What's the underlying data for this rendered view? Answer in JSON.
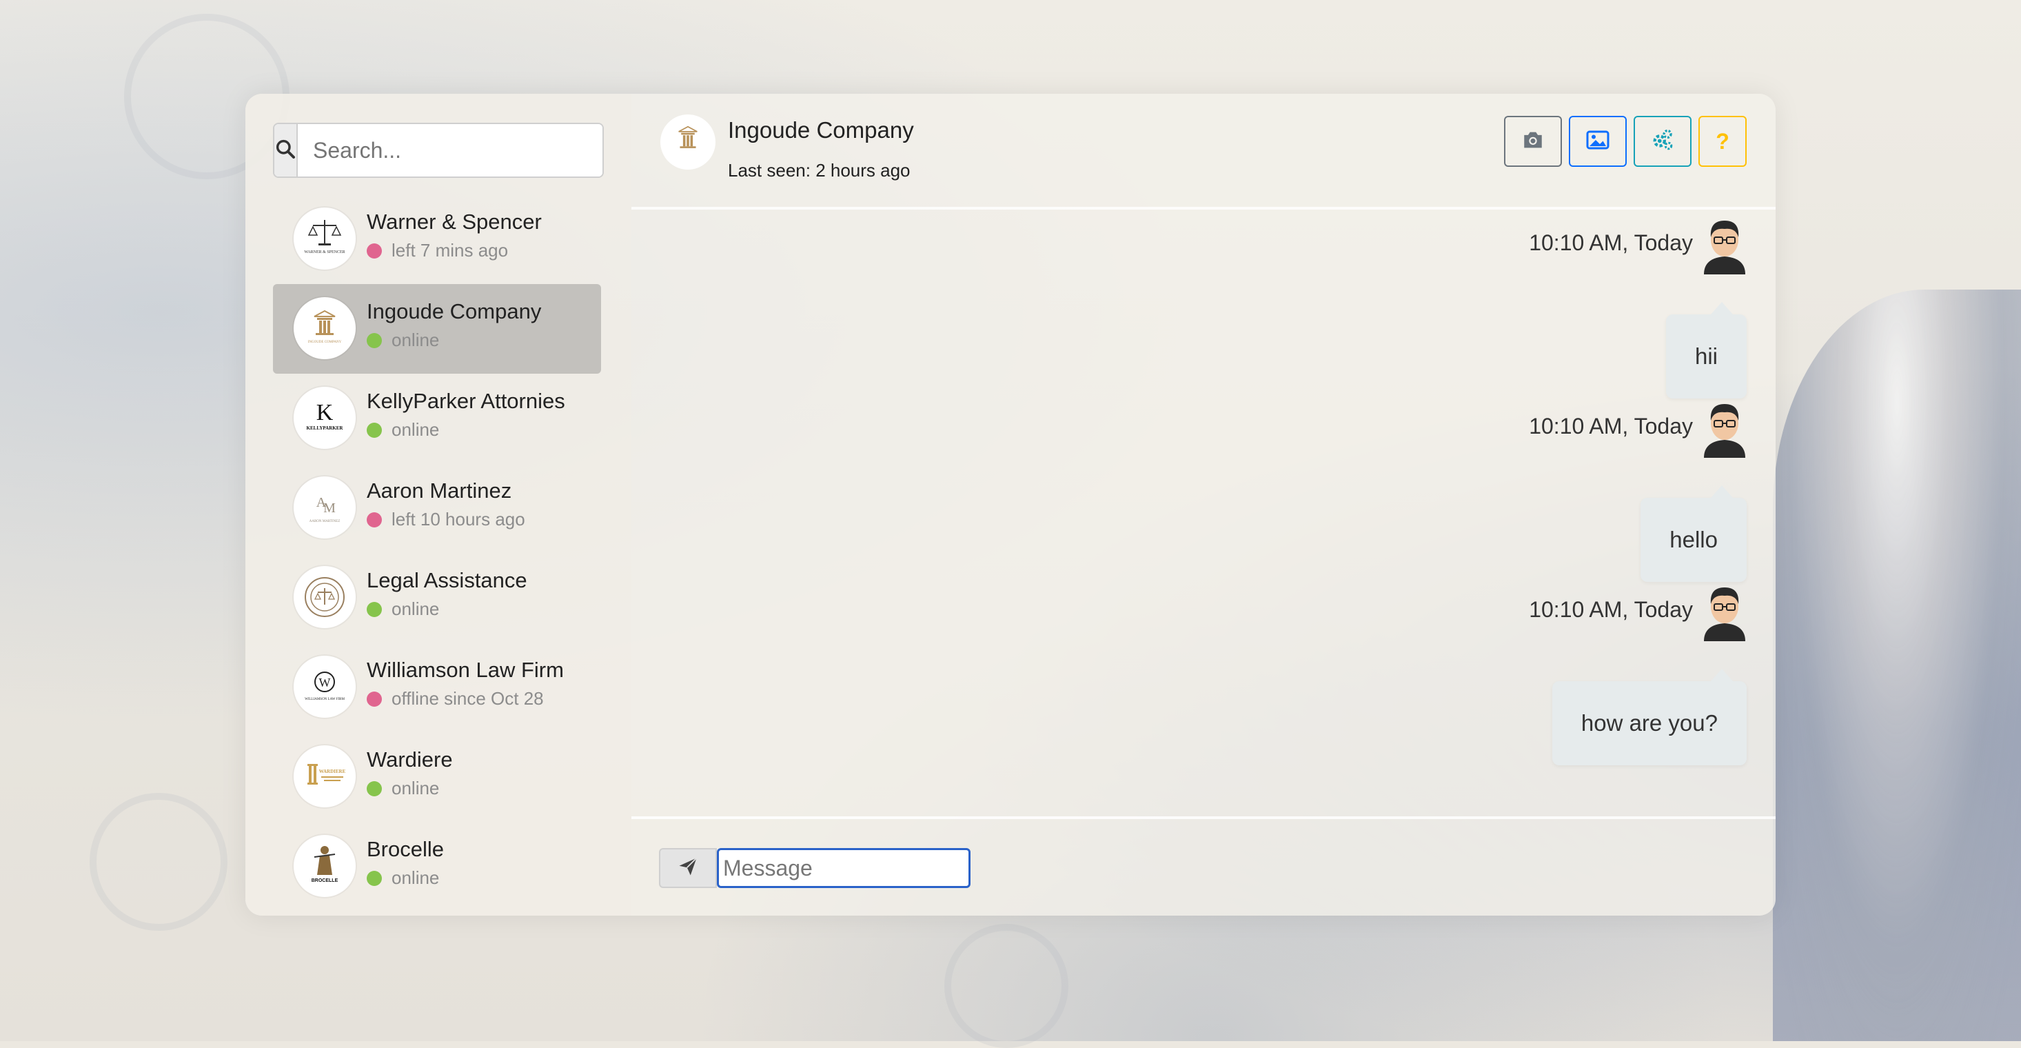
{
  "search": {
    "placeholder": "Search..."
  },
  "contacts": [
    {
      "name": "Warner & Spencer",
      "status": "left 7 mins ago",
      "online": false,
      "logo_text": "WARNER & SPENCER"
    },
    {
      "name": "Ingoude Company",
      "status": "online",
      "online": true,
      "active": true,
      "logo_text": "INGOUDE COMPANY"
    },
    {
      "name": "KellyParker Attornies",
      "status": "online",
      "online": true,
      "logo_text": "KELLYPARKER"
    },
    {
      "name": "Aaron Martinez",
      "status": "left 10 hours ago",
      "online": false,
      "logo_text": "AARON MARTINEZ"
    },
    {
      "name": "Legal Assistance",
      "status": "online",
      "online": true,
      "logo_text": ""
    },
    {
      "name": "Williamson Law Firm",
      "status": "offline since Oct 28",
      "online": false,
      "logo_text": "WILLIAMSON LAW FIRM"
    },
    {
      "name": "Wardiere",
      "status": "online",
      "online": true,
      "logo_text": "WARDIERE"
    },
    {
      "name": "Brocelle",
      "status": "online",
      "online": true,
      "logo_text": "BROCELLE"
    }
  ],
  "chat": {
    "name": "Ingoude Company",
    "last_seen": "Last seen: 2 hours ago",
    "header_buttons": [
      {
        "icon": "camera-icon",
        "color": "#6c757d"
      },
      {
        "icon": "image-icon",
        "color": "#0d6efd"
      },
      {
        "icon": "gears-icon",
        "color": "#17a2b8"
      },
      {
        "icon": "question-icon",
        "color": "#ffc107",
        "label": "?"
      }
    ],
    "messages": [
      {
        "time": "10:10 AM, Today",
        "text": "hii"
      },
      {
        "time": "10:10 AM, Today",
        "text": "hello"
      },
      {
        "time": "10:10 AM, Today",
        "text": "how are you?"
      }
    ],
    "input_placeholder": "Message"
  },
  "colors": {
    "online": "#86c44c",
    "offline": "#e0658f",
    "active_contact": "#c3c1bd",
    "input_focus": "#2a62c9"
  }
}
